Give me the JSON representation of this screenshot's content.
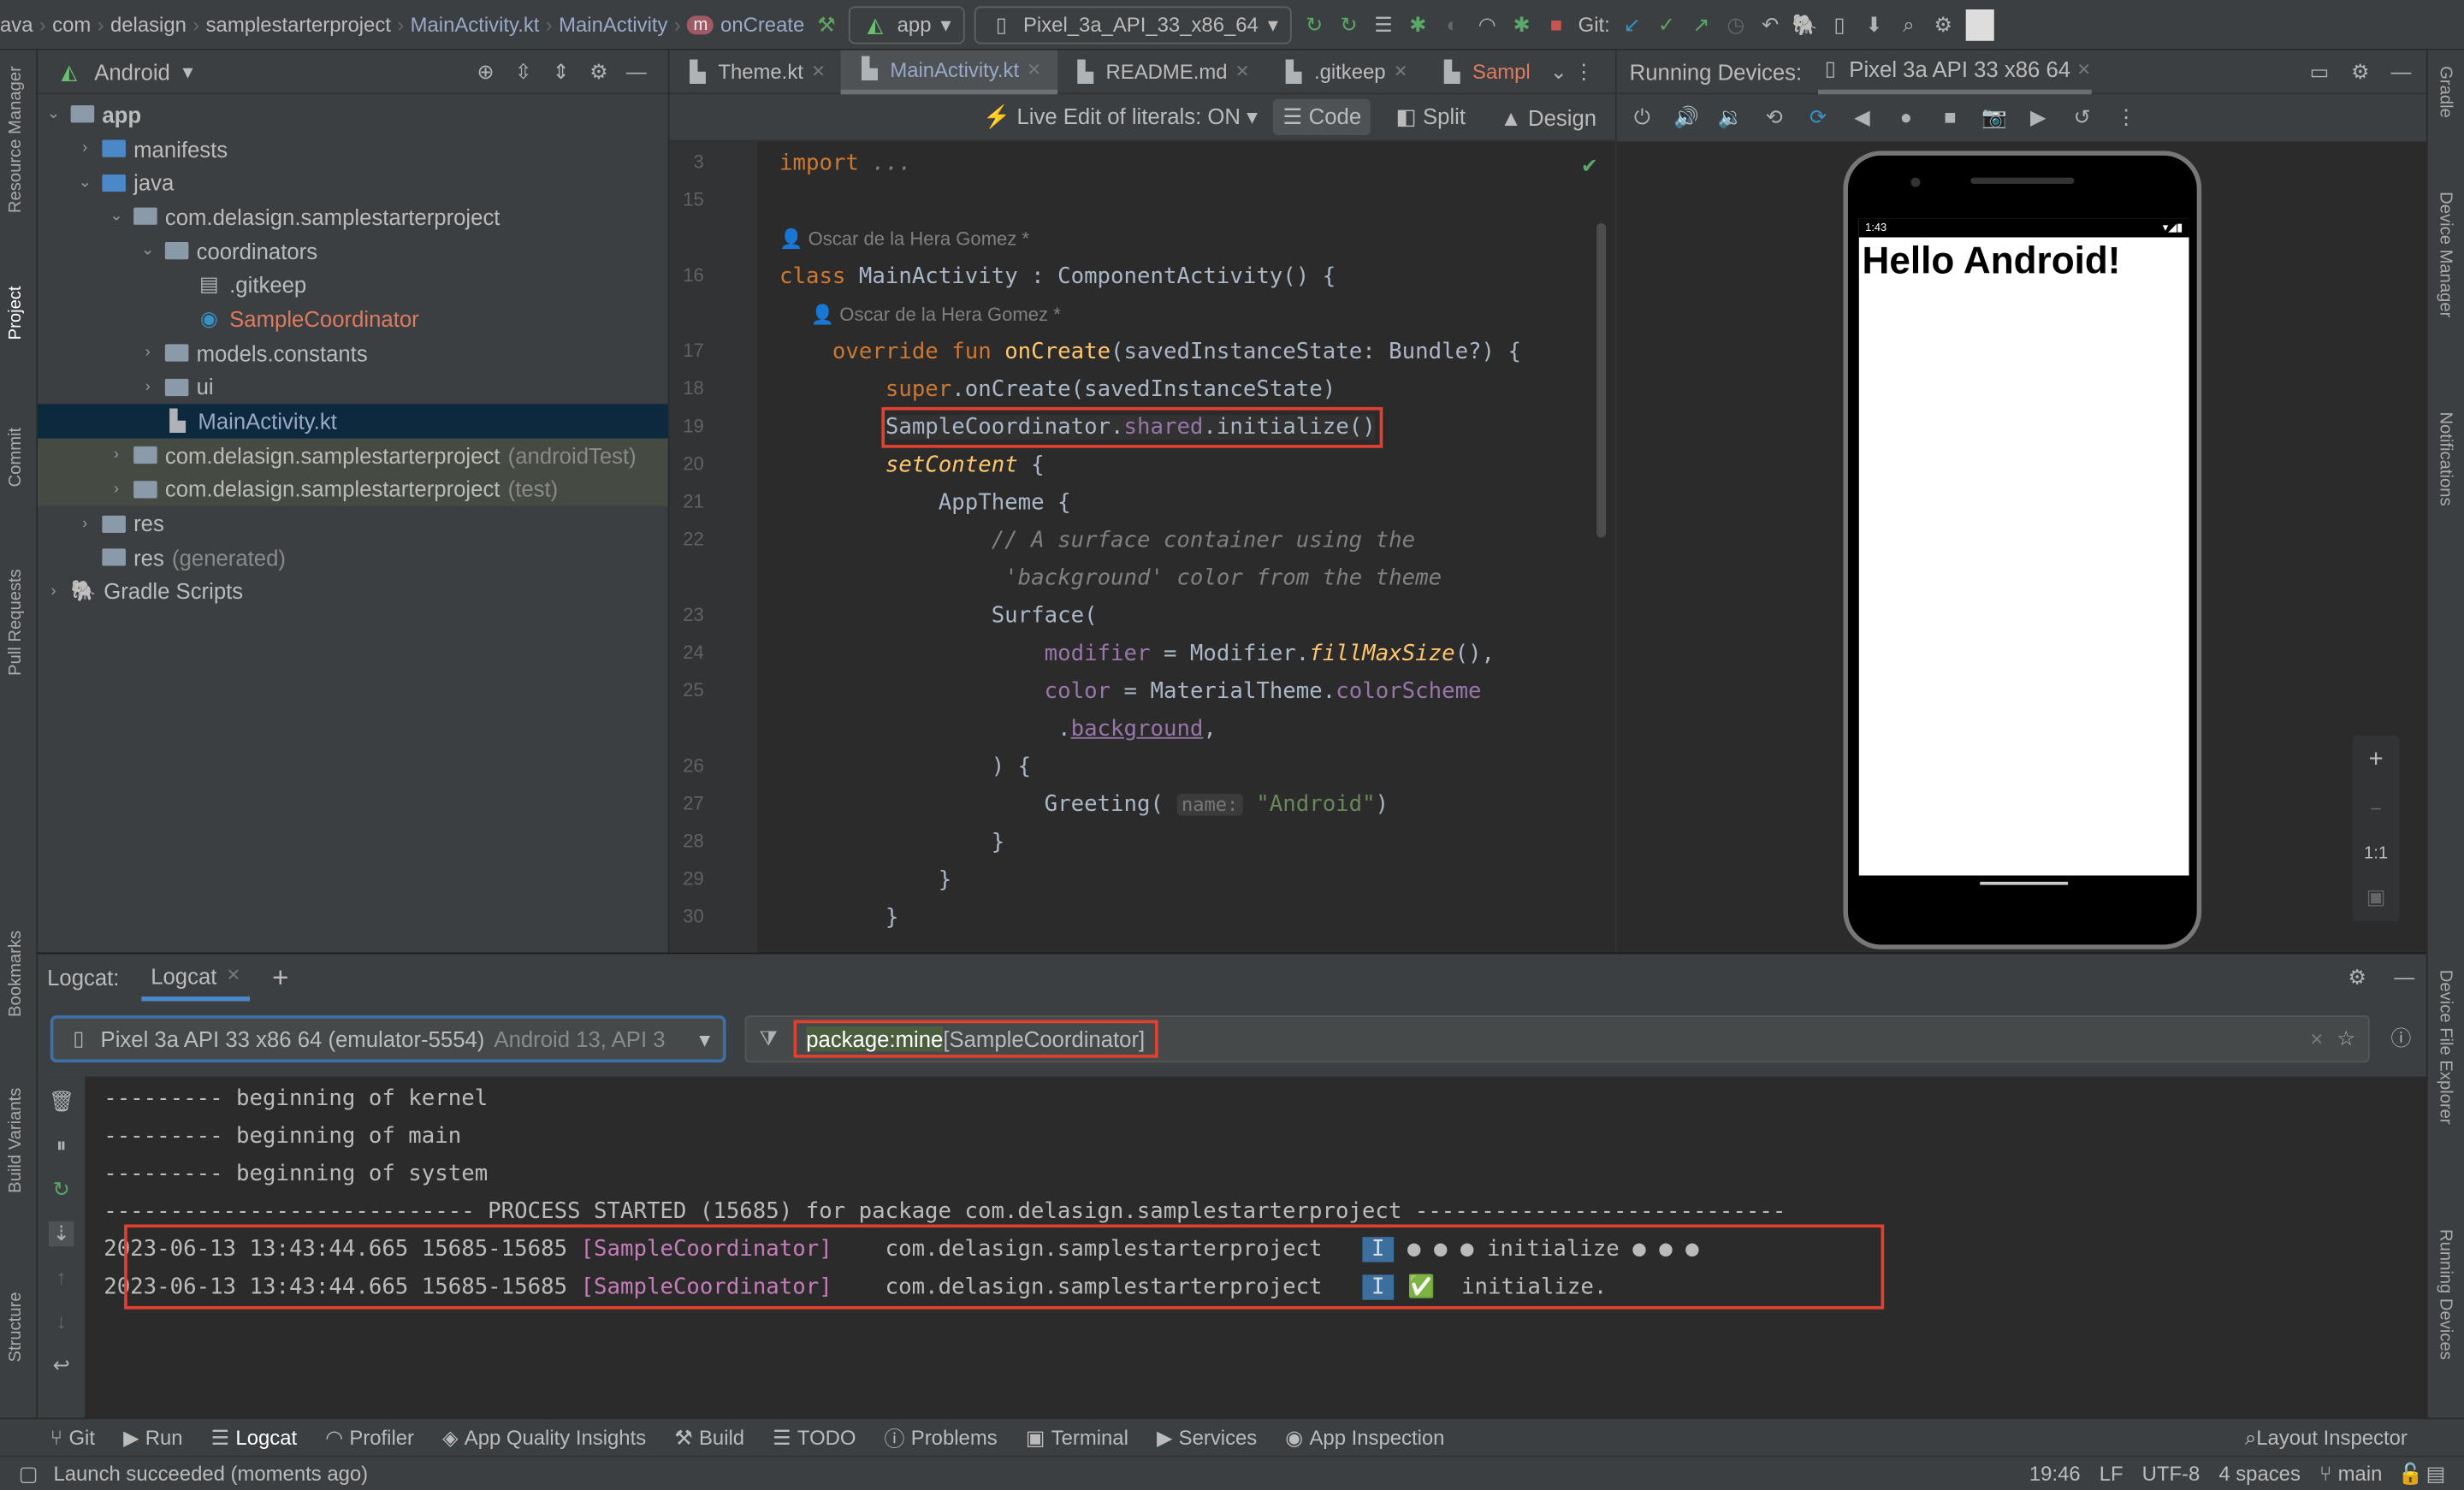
{
  "breadcrumb": [
    "ava",
    "com",
    "delasign",
    "samplestarterproject",
    "MainActivity.kt",
    "MainActivity",
    "onCreate"
  ],
  "toolbar": {
    "run_config": "app",
    "device": "Pixel_3a_API_33_x86_64",
    "git_label": "Git:"
  },
  "project": {
    "view": "Android",
    "items": [
      {
        "label": "app",
        "depth": 0,
        "arrow": "open",
        "icon": "folder",
        "bold": true
      },
      {
        "label": "manifests",
        "depth": 1,
        "arrow": "closed",
        "icon": "folder-blue"
      },
      {
        "label": "java",
        "depth": 1,
        "arrow": "open",
        "icon": "folder-blue"
      },
      {
        "label": "com.delasign.samplestarterproject",
        "depth": 2,
        "arrow": "open",
        "icon": "package"
      },
      {
        "label": "coordinators",
        "depth": 3,
        "arrow": "open",
        "icon": "package"
      },
      {
        "label": ".gitkeep",
        "depth": 4,
        "arrow": "",
        "icon": "file"
      },
      {
        "label": "SampleCoordinator",
        "depth": 4,
        "arrow": "",
        "icon": "kotlin-class",
        "color": "#e07a5f"
      },
      {
        "label": "models.constants",
        "depth": 3,
        "arrow": "closed",
        "icon": "package"
      },
      {
        "label": "ui",
        "depth": 3,
        "arrow": "closed",
        "icon": "package"
      },
      {
        "label": "MainActivity.kt",
        "depth": 3,
        "arrow": "",
        "icon": "kotlin-file",
        "color": "#9aa9c8",
        "selected": true
      },
      {
        "label": "com.delasign.samplestarterproject",
        "suffix": "(androidTest)",
        "depth": 2,
        "arrow": "closed",
        "icon": "package",
        "group": true
      },
      {
        "label": "com.delasign.samplestarterproject",
        "suffix": "(test)",
        "depth": 2,
        "arrow": "closed",
        "icon": "package",
        "group": true
      },
      {
        "label": "res",
        "depth": 1,
        "arrow": "closed",
        "icon": "folder"
      },
      {
        "label": "res",
        "suffix": "(generated)",
        "depth": 1,
        "arrow": "",
        "icon": "folder"
      },
      {
        "label": "Gradle Scripts",
        "depth": 0,
        "arrow": "closed",
        "icon": "gradle"
      }
    ]
  },
  "editor": {
    "tabs": [
      {
        "label": "Theme.kt"
      },
      {
        "label": "MainActivity.kt",
        "active": true
      },
      {
        "label": "README.md"
      },
      {
        "label": ".gitkeep"
      },
      {
        "label": "Sampl",
        "color": "#e07a5f"
      }
    ],
    "live_edit": "Live Edit of literals: ON",
    "modes": [
      "Code",
      "Split",
      "Design"
    ],
    "lines": [
      {
        "n": "3",
        "t": [
          [
            "kw",
            "import "
          ],
          [
            "cm",
            "..."
          ]
        ]
      },
      {
        "n": "15",
        "t": []
      },
      {
        "n": "",
        "t": [
          [
            "auth",
            "👤 Oscar de la Hera Gomez *"
          ]
        ]
      },
      {
        "n": "16",
        "t": [
          [
            "kw",
            "class "
          ],
          [
            "",
            "MainActivity : ComponentActivity() {"
          ]
        ]
      },
      {
        "n": "",
        "t": [
          [
            "auth",
            "      👤 Oscar de la Hera Gomez *"
          ]
        ]
      },
      {
        "n": "17",
        "t": [
          [
            "",
            "    "
          ],
          [
            "kw",
            "override fun "
          ],
          [
            "fn",
            "onCreate"
          ],
          [
            "",
            "(savedInstanceState: Bundle?) {"
          ]
        ]
      },
      {
        "n": "18",
        "t": [
          [
            "",
            "        "
          ],
          [
            "kw",
            "super"
          ],
          [
            "",
            ".onCreate(savedInstanceState)"
          ]
        ]
      },
      {
        "n": "19",
        "t": [
          [
            "",
            "        SampleCoordinator."
          ],
          [
            "pr",
            "shared"
          ],
          [
            "",
            ".initialize()"
          ]
        ],
        "boxed": true
      },
      {
        "n": "20",
        "t": [
          [
            "",
            "        "
          ],
          [
            "it",
            "setContent"
          ],
          [
            "",
            " {"
          ]
        ]
      },
      {
        "n": "21",
        "t": [
          [
            "",
            "            AppTheme {"
          ]
        ]
      },
      {
        "n": "22",
        "t": [
          [
            "",
            "                "
          ],
          [
            "cm",
            "// A surface container using the"
          ]
        ]
      },
      {
        "n": "",
        "t": [
          [
            "",
            "                 "
          ],
          [
            "cm",
            "'background' color from the theme"
          ]
        ]
      },
      {
        "n": "23",
        "t": [
          [
            "",
            "                Surface("
          ]
        ]
      },
      {
        "n": "24",
        "t": [
          [
            "",
            "                    "
          ],
          [
            "pr",
            "modifier"
          ],
          [
            "",
            " = Modifier."
          ],
          [
            "it",
            "fillMaxSize"
          ],
          [
            "",
            "(),"
          ]
        ]
      },
      {
        "n": "25",
        "t": [
          [
            "",
            "                    "
          ],
          [
            "pr",
            "color"
          ],
          [
            "",
            " = MaterialTheme."
          ],
          [
            "pr",
            "colorScheme"
          ]
        ]
      },
      {
        "n": "",
        "t": [
          [
            "",
            "                     ."
          ],
          [
            "pr ul",
            "background"
          ],
          [
            ",",
            ","
          ]
        ]
      },
      {
        "n": "26",
        "t": [
          [
            "",
            "                ) {"
          ]
        ]
      },
      {
        "n": "27",
        "t": [
          [
            "",
            "                    Greeting( "
          ],
          [
            "hint",
            "name:"
          ],
          [
            "str",
            " \"Android\""
          ],
          [
            "",
            ")"
          ]
        ]
      },
      {
        "n": "28",
        "t": [
          [
            "",
            "                }"
          ]
        ]
      },
      {
        "n": "29",
        "t": [
          [
            "",
            "            }"
          ]
        ]
      },
      {
        "n": "30",
        "t": [
          [
            "",
            "        }"
          ]
        ]
      }
    ]
  },
  "devices": {
    "title": "Running Devices:",
    "tab": "Pixel 3a API 33 x86 64",
    "status_time": "1:43",
    "screen_text": "Hello Android!",
    "zoom_labels": [
      "+",
      "−",
      "1:1"
    ]
  },
  "logcat": {
    "title": "Logcat:",
    "tab": "Logcat",
    "device": "Pixel 3a API 33 x86 64 (emulator-5554)",
    "device_detail": "Android 13, API 3",
    "filter_key": "package:mine",
    "filter_rest": " [SampleCoordinator]",
    "plain": [
      "--------- beginning of kernel",
      "--------- beginning of main",
      "--------- beginning of system",
      "---------------------------- PROCESS STARTED (15685) for package com.delasign.samplestarterproject ----------------------------"
    ],
    "entries": [
      {
        "ts": "2023-06-13 13:43:44.665 15685-15685",
        "tag": "[SampleCoordinator]",
        "pkg": "com.delasign.samplestarterproject",
        "level": "I",
        "msg": "● ● ● initialize ● ● ●"
      },
      {
        "ts": "2023-06-13 13:43:44.665 15685-15685",
        "tag": "[SampleCoordinator]",
        "pkg": "com.delasign.samplestarterproject",
        "level": "I",
        "msg": "✅  initialize."
      }
    ]
  },
  "left_tools": [
    "Resource Manager",
    "Project",
    "Commit",
    "Pull Requests",
    "Bookmarks",
    "Build Variants",
    "Structure"
  ],
  "right_tools": [
    "Gradle",
    "Device Manager",
    "Notifications",
    "Device File Explorer",
    "Running Devices"
  ],
  "bottom_tools": [
    "Git",
    "Run",
    "Logcat",
    "Profiler",
    "App Quality Insights",
    "Build",
    "TODO",
    "Problems",
    "Terminal",
    "Services",
    "App Inspection"
  ],
  "layout_inspector": "Layout Inspector",
  "status": {
    "message": "Launch succeeded (moments ago)",
    "position": "19:46",
    "line_sep": "LF",
    "encoding": "UTF-8",
    "indent": "4 spaces",
    "branch": "main"
  }
}
